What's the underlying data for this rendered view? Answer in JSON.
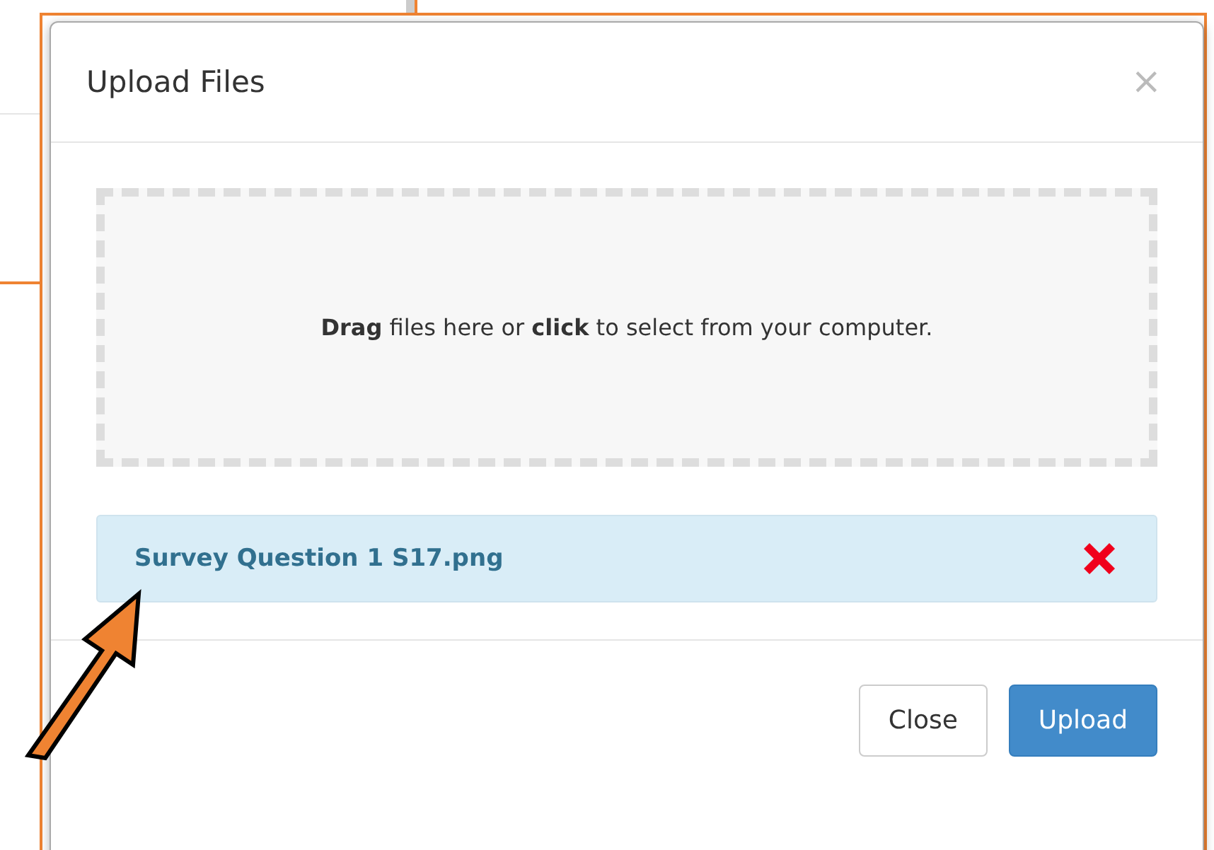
{
  "dialog": {
    "title": "Upload Files",
    "close_glyph": "×"
  },
  "dropzone": {
    "text": "**Drag** files here or **click** to select from your computer."
  },
  "files": [
    {
      "name": "Survey Question 1 S17.png"
    }
  ],
  "buttons": [
    {
      "label": "Close",
      "kind": "default"
    },
    {
      "label": "Upload",
      "kind": "primary"
    }
  ]
}
